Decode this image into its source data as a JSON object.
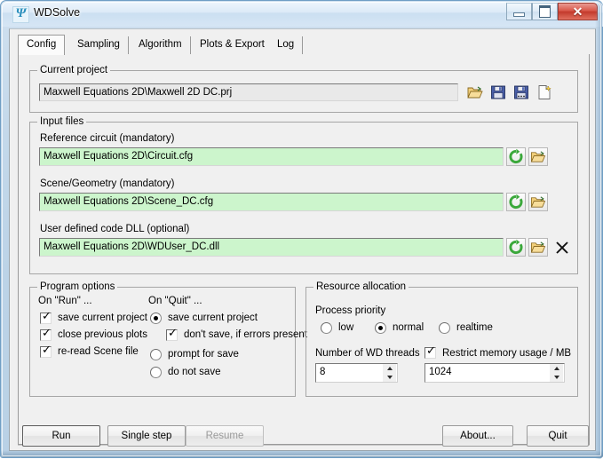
{
  "window": {
    "title": "WDSolve",
    "app_icon": "wdsolve-logo-icon",
    "controls": {
      "minimize": "minimize-icon",
      "maximize": "maximize-icon",
      "close": "✕"
    }
  },
  "tabs": [
    {
      "label": "Config",
      "active": true
    },
    {
      "label": "Sampling",
      "active": false
    },
    {
      "label": "Algorithm",
      "active": false
    },
    {
      "label": "Plots & Export",
      "active": false
    },
    {
      "label": "Log",
      "active": false
    }
  ],
  "current_project": {
    "caption": "Current project",
    "path": "Maxwell Equations 2D\\Maxwell 2D DC.prj",
    "buttons": [
      {
        "name": "open-project-button",
        "icon": "folder-open-icon"
      },
      {
        "name": "save-project-button",
        "icon": "floppy-save-icon"
      },
      {
        "name": "save-project-as-button",
        "icon": "floppy-save-as-icon"
      },
      {
        "name": "new-project-button",
        "icon": "new-file-icon"
      }
    ]
  },
  "input_files": {
    "caption": "Input files",
    "rows": [
      {
        "label": "Reference circuit (mandatory)",
        "value": "Maxwell Equations 2D\\Circuit.cfg",
        "reload_icon": "refresh-icon",
        "browse_icon": "folder-open-icon",
        "has_clear": false
      },
      {
        "label": "Scene/Geometry (mandatory)",
        "value": "Maxwell Equations 2D\\Scene_DC.cfg",
        "reload_icon": "refresh-icon",
        "browse_icon": "folder-open-icon",
        "has_clear": false
      },
      {
        "label": "User defined code DLL (optional)",
        "value": "Maxwell Equations 2D\\WDUser_DC.dll",
        "reload_icon": "refresh-icon",
        "browse_icon": "folder-open-icon",
        "has_clear": true,
        "clear_icon": "✕"
      }
    ]
  },
  "program_options": {
    "caption": "Program options",
    "on_run": {
      "heading": "On \"Run\" ...",
      "items": [
        {
          "label": "save current project",
          "checked": true
        },
        {
          "label": "close previous plots",
          "checked": true
        },
        {
          "label": "re-read Scene file",
          "checked": true
        }
      ]
    },
    "on_quit": {
      "heading": "On \"Quit\" ...",
      "radios": [
        {
          "label": "save current project",
          "selected": true
        },
        {
          "label": "prompt for save",
          "selected": false
        },
        {
          "label": "do not save",
          "selected": false
        }
      ],
      "sub_checkbox": {
        "label": "don't save, if errors present",
        "checked": true
      }
    }
  },
  "resource_allocation": {
    "caption": "Resource allocation",
    "priority": {
      "heading": "Process priority",
      "options": [
        {
          "label": "low",
          "selected": false
        },
        {
          "label": "normal",
          "selected": true
        },
        {
          "label": "realtime",
          "selected": false
        }
      ]
    },
    "threads": {
      "label": "Number of WD threads",
      "value": "8"
    },
    "memory": {
      "label": "Restrict memory usage / MB",
      "checked": true,
      "value": "1024"
    }
  },
  "footer_buttons": [
    {
      "label": "Run",
      "state": "default"
    },
    {
      "label": "Single step",
      "state": "normal"
    },
    {
      "label": "Resume",
      "state": "disabled"
    },
    {
      "label": "About...",
      "state": "normal"
    },
    {
      "label": "Quit",
      "state": "normal"
    }
  ],
  "colors": {
    "input_valid_green": "#ccf5cc",
    "dialog_face": "#f0f0f0",
    "close_button_red": "#c33a2c",
    "refresh_icon_green": "#3ba83b",
    "folder_icon_yellow": "#e9c15a"
  }
}
